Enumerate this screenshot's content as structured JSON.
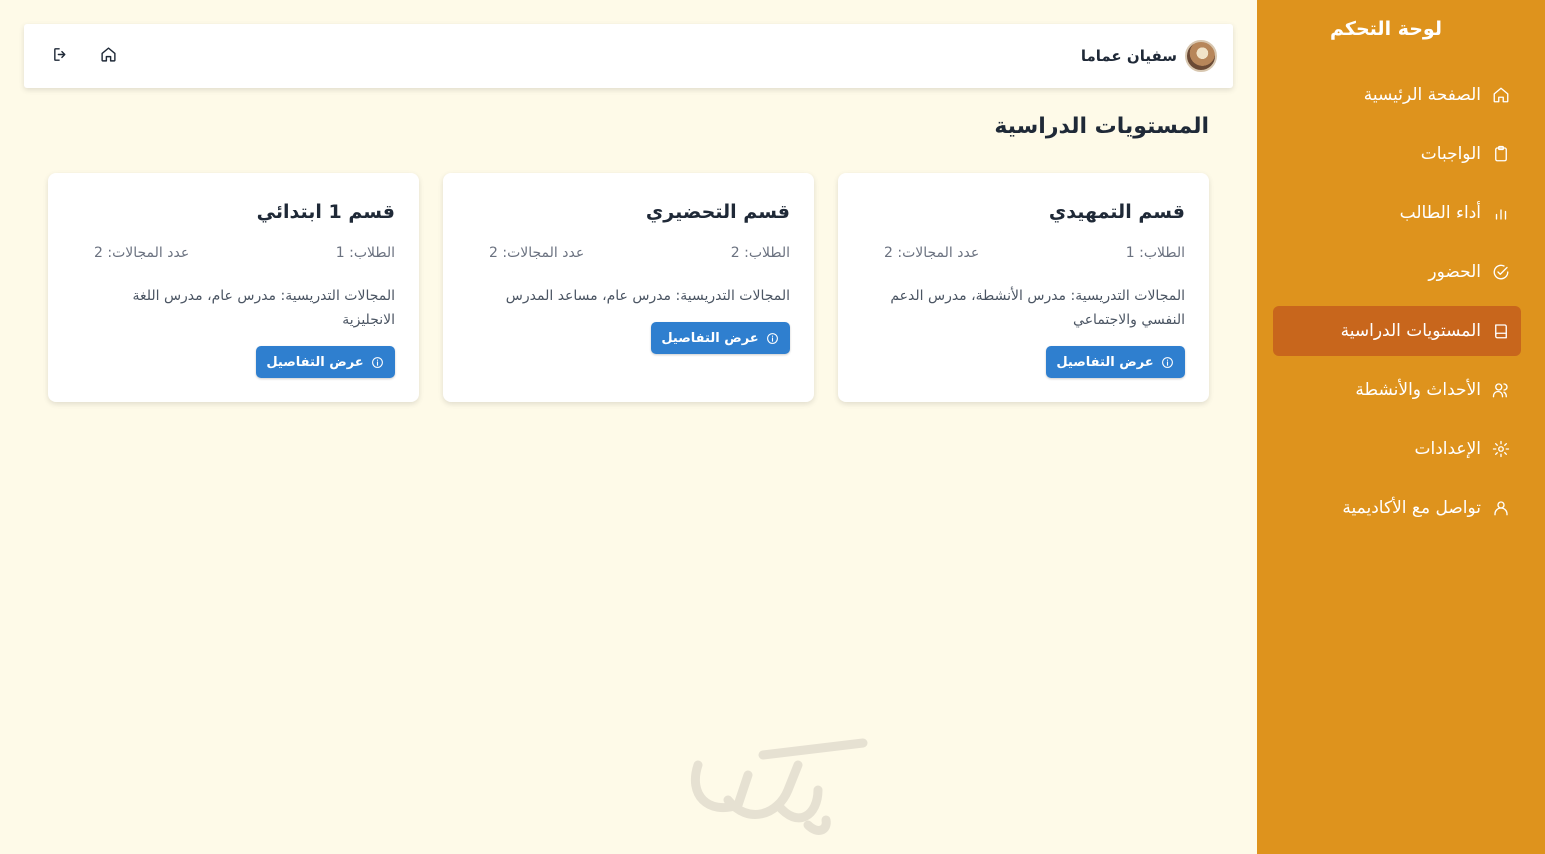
{
  "sidebar": {
    "title": "لوحة التحكم",
    "items": [
      {
        "label": "الصفحة الرئيسية",
        "icon": "home-icon",
        "active": false
      },
      {
        "label": "الواجبات",
        "icon": "clipboard-icon",
        "active": false
      },
      {
        "label": "أداء الطالب",
        "icon": "bar-chart-icon",
        "active": false
      },
      {
        "label": "الحضور",
        "icon": "check-circle-icon",
        "active": false
      },
      {
        "label": "المستويات الدراسية",
        "icon": "book-icon",
        "active": true
      },
      {
        "label": "الأحداث والأنشطة",
        "icon": "users-icon",
        "active": false
      },
      {
        "label": "الإعدادات",
        "icon": "gear-icon",
        "active": false
      },
      {
        "label": "تواصل مع الأكاديمية",
        "icon": "user-icon",
        "active": false
      }
    ]
  },
  "header": {
    "user_name": "سفيان عماما",
    "home_icon": "home-icon",
    "logout_icon": "logout-icon"
  },
  "main": {
    "title": "المستويات الدراسية",
    "cards": [
      {
        "title": "قسم التمهيدي",
        "students": "الطلاب: 1",
        "fields_count": "عدد المجالات: 2",
        "fields": "المجالات التدريسية: مدرس الأنشطة، مدرس الدعم النفسي والاجتماعي",
        "button": "عرض التفاصيل"
      },
      {
        "title": "قسم التحضيري",
        "students": "الطلاب: 2",
        "fields_count": "عدد المجالات: 2",
        "fields": "المجالات التدريسية: مدرس عام، مساعد المدرس",
        "button": "عرض التفاصيل"
      },
      {
        "title": "قسم 1 ابتدائي",
        "students": "الطلاب: 1",
        "fields_count": "عدد المجالات: 2",
        "fields": "المجالات التدريسية: مدرس عام، مدرس اللغة الانجليزية",
        "button": "عرض التفاصيل"
      }
    ]
  },
  "colors": {
    "sidebar": "#de931d",
    "sidebar_active": "#c8661c",
    "background": "#fefae8",
    "button": "#2f7fcf"
  }
}
